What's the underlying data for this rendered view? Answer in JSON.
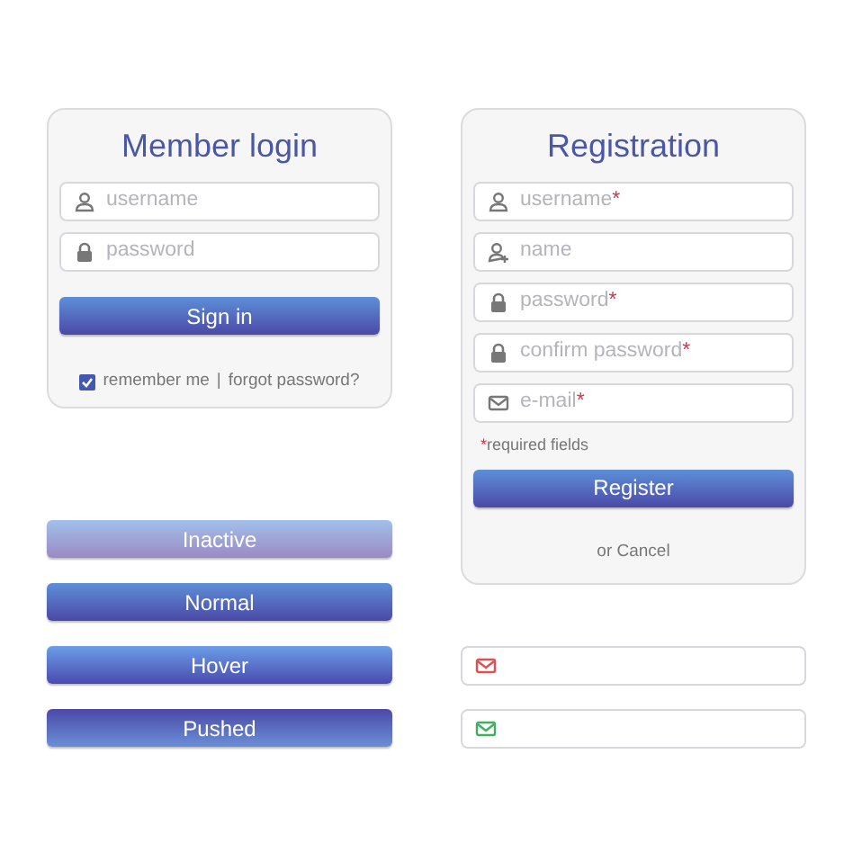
{
  "login": {
    "title": "Member login",
    "fields": [
      {
        "kind": "user",
        "placeholder": "username"
      },
      {
        "kind": "lock",
        "placeholder": "password"
      }
    ],
    "submit": "Sign in",
    "remember": {
      "label": "remember me",
      "checked": true
    },
    "separator": "|",
    "forgot": "forgot password?"
  },
  "registration": {
    "title": "Registration",
    "fields": [
      {
        "kind": "user",
        "placeholder": "username",
        "required": true
      },
      {
        "kind": "user-plus",
        "placeholder": "name",
        "required": false
      },
      {
        "kind": "lock",
        "placeholder": "password",
        "required": true
      },
      {
        "kind": "lock",
        "placeholder": "confirm password",
        "required": true
      },
      {
        "kind": "mail",
        "placeholder": "e-mail",
        "required": true
      }
    ],
    "required_mark": "*",
    "note": "required fields",
    "submit": "Register",
    "cancel": "or Cancel"
  },
  "button_states": [
    {
      "label": "Inactive",
      "kind": "inactive"
    },
    {
      "label": "Normal",
      "kind": "normal"
    },
    {
      "label": "Hover",
      "kind": "hover"
    },
    {
      "label": "Pushed",
      "kind": "pushed"
    }
  ],
  "validation_fields": [
    {
      "color": "#e05050"
    },
    {
      "color": "#40b060"
    }
  ]
}
